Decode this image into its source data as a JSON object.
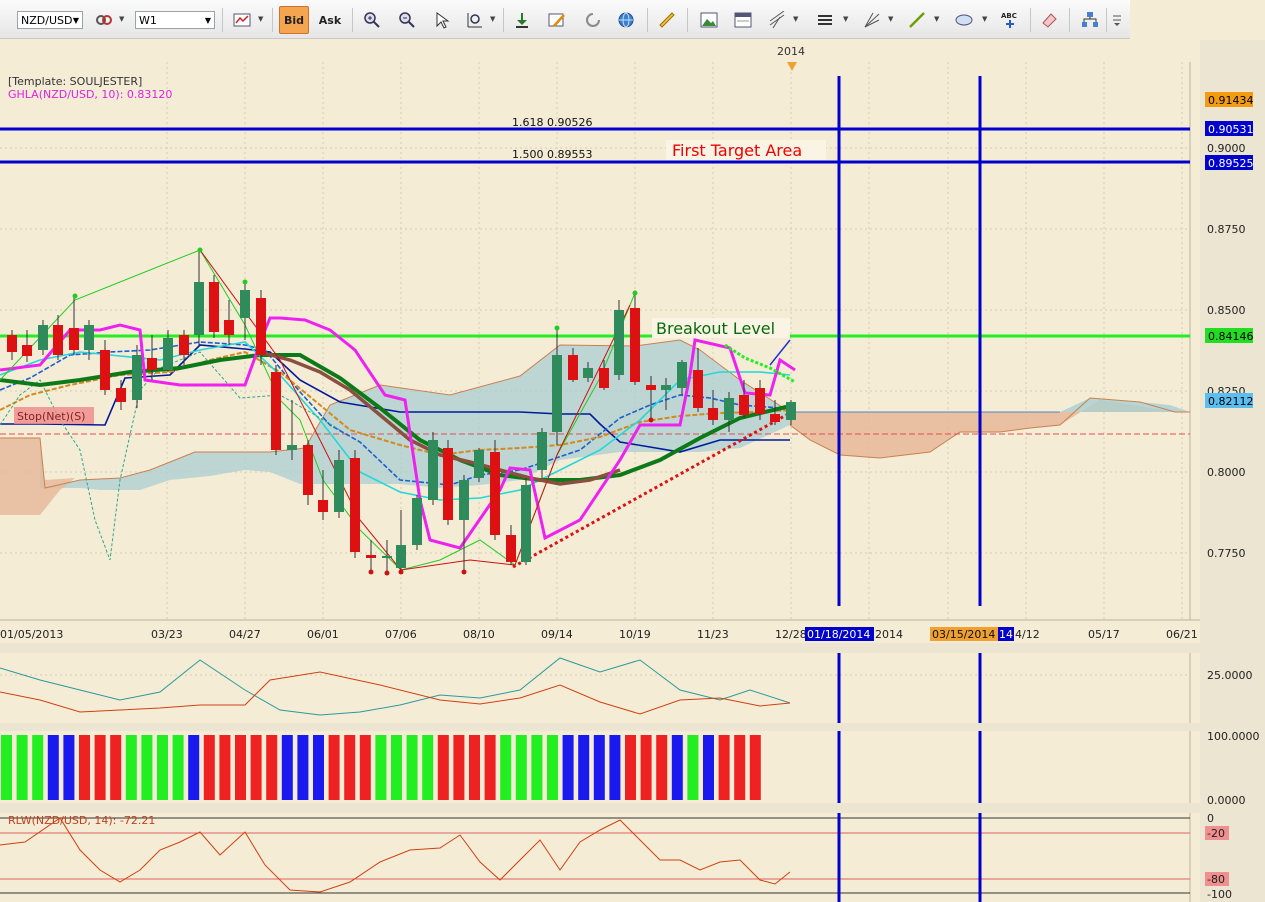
{
  "toolbar": {
    "symbol": "NZD/USD",
    "timeframe": "W1",
    "bid_label": "Bid",
    "ask_label": "Ask",
    "text_tool_label": "ABC"
  },
  "chart": {
    "template_label": "[Template: SOULJESTER]",
    "ghla_label": "GHLA(NZD/USD, 10): 0.83120",
    "stop_label": "Stop(Net)(S)",
    "year_marker": "2014",
    "fib_1618": "1.618 0.90526",
    "fib_1500": "1.500 0.89553",
    "first_target_label": "First Target Area",
    "breakout_label": "Breakout Level",
    "price_ticks": [
      "0.9000",
      "0.8750",
      "0.8500",
      "0.8250",
      "0.8000",
      "0.7750"
    ],
    "price_tags": [
      {
        "value": "0.91434",
        "bg": "#f39c12",
        "fg": "#000000"
      },
      {
        "value": "0.90531",
        "bg": "#0000cc",
        "fg": "#ffffff"
      },
      {
        "value": "0.89525",
        "bg": "#0000cc",
        "fg": "#ffffff"
      },
      {
        "value": "0.84146",
        "bg": "#22dd22",
        "fg": "#000000"
      },
      {
        "value": "0.82112",
        "bg": "#5bbef0",
        "fg": "#000000"
      }
    ],
    "date_labels": [
      "01/05/2013",
      "03/23",
      "04/27",
      "06/01",
      "07/06",
      "08/10",
      "09/14",
      "10/19",
      "11/23",
      "12/28",
      "2014",
      "4/12",
      "05/17",
      "06/21"
    ],
    "date_tag_blue": "01/18/2014",
    "date_tag_orange": "03/15/2014",
    "date_tag_small": "14"
  },
  "osc1": {
    "tick": "25.0000"
  },
  "osc2": {
    "tick_top": "100.0000",
    "tick_bottom": "0.0000"
  },
  "rlw": {
    "label": "RLW(NZD/USD, 14): -72.21",
    "ticks": [
      "0",
      "-20",
      "-80",
      "-100"
    ]
  },
  "colors": {
    "bull_candle": "#2f8a5c",
    "bear_candle": "#dd1111",
    "target_lines": "#0000cc",
    "breakout_line": "#22ee22",
    "ghla": "#ee22ee",
    "cloud": "#a9cfd2"
  }
}
